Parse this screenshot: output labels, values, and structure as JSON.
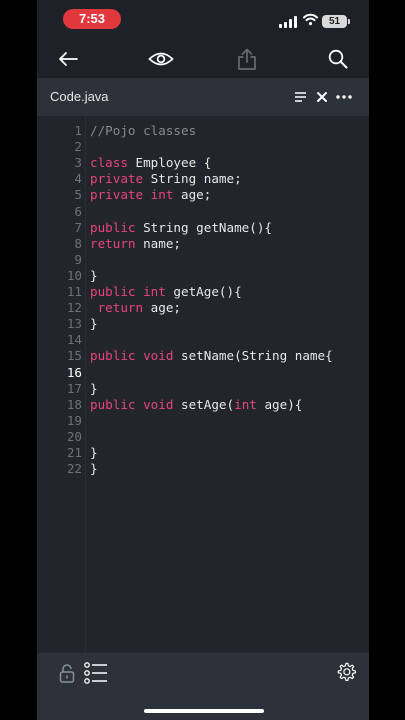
{
  "status": {
    "time": "7:53",
    "battery": "51"
  },
  "colors": {
    "background": "#1e2127",
    "header": "#2d3139",
    "editor": "#22252b",
    "keyword": "#e8457a",
    "comment": "#858a92",
    "time_pill": "#e0383c"
  },
  "toolbar": {
    "icons": [
      "back-arrow-icon",
      "eye-icon",
      "share-icon",
      "search-icon"
    ]
  },
  "file": {
    "name": "Code.java",
    "icons": [
      "format-lines-icon",
      "close-icon",
      "more-icon"
    ]
  },
  "editor": {
    "active_line": 16,
    "lines": [
      {
        "num": "1",
        "tokens": [
          [
            "comment",
            "//Pojo classes"
          ]
        ]
      },
      {
        "num": "2",
        "tokens": []
      },
      {
        "num": "3",
        "tokens": [
          [
            "kw",
            "class"
          ],
          [
            "plain",
            " Employee {"
          ]
        ]
      },
      {
        "num": "4",
        "tokens": [
          [
            "kw",
            "private"
          ],
          [
            "plain",
            " String name;"
          ]
        ]
      },
      {
        "num": "5",
        "tokens": [
          [
            "kw",
            "private"
          ],
          [
            "plain",
            " "
          ],
          [
            "kw",
            "int"
          ],
          [
            "plain",
            " age;"
          ]
        ]
      },
      {
        "num": "6",
        "tokens": []
      },
      {
        "num": "7",
        "tokens": [
          [
            "kw",
            "public"
          ],
          [
            "plain",
            " String getName(){"
          ]
        ]
      },
      {
        "num": "8",
        "tokens": [
          [
            "kw",
            "return"
          ],
          [
            "plain",
            " name;"
          ]
        ]
      },
      {
        "num": "9",
        "tokens": []
      },
      {
        "num": "10",
        "tokens": [
          [
            "plain",
            "}"
          ]
        ]
      },
      {
        "num": "11",
        "tokens": [
          [
            "kw",
            "public"
          ],
          [
            "plain",
            " "
          ],
          [
            "kw",
            "int"
          ],
          [
            "plain",
            " getAge(){"
          ]
        ]
      },
      {
        "num": "12",
        "tokens": [
          [
            "plain",
            " "
          ],
          [
            "kw",
            "return"
          ],
          [
            "plain",
            " age;"
          ]
        ]
      },
      {
        "num": "13",
        "tokens": [
          [
            "plain",
            "}"
          ]
        ]
      },
      {
        "num": "14",
        "tokens": []
      },
      {
        "num": "15",
        "tokens": [
          [
            "kw",
            "public"
          ],
          [
            "plain",
            " "
          ],
          [
            "kw",
            "void"
          ],
          [
            "plain",
            " setName(String name{"
          ]
        ]
      },
      {
        "num": "16",
        "tokens": []
      },
      {
        "num": "17",
        "tokens": [
          [
            "plain",
            "}"
          ]
        ]
      },
      {
        "num": "18",
        "tokens": [
          [
            "kw",
            "public"
          ],
          [
            "plain",
            " "
          ],
          [
            "kw",
            "void"
          ],
          [
            "plain",
            " setAge("
          ],
          [
            "kw",
            "int"
          ],
          [
            "plain",
            " age){"
          ]
        ]
      },
      {
        "num": "19",
        "tokens": []
      },
      {
        "num": "20",
        "tokens": []
      },
      {
        "num": "21",
        "tokens": [
          [
            "plain",
            "}"
          ]
        ]
      },
      {
        "num": "22",
        "tokens": [
          [
            "plain",
            "}"
          ]
        ]
      }
    ]
  },
  "bottom_bar": {
    "icons": [
      "lock-icon",
      "list-icon",
      "settings-gear-icon"
    ]
  }
}
